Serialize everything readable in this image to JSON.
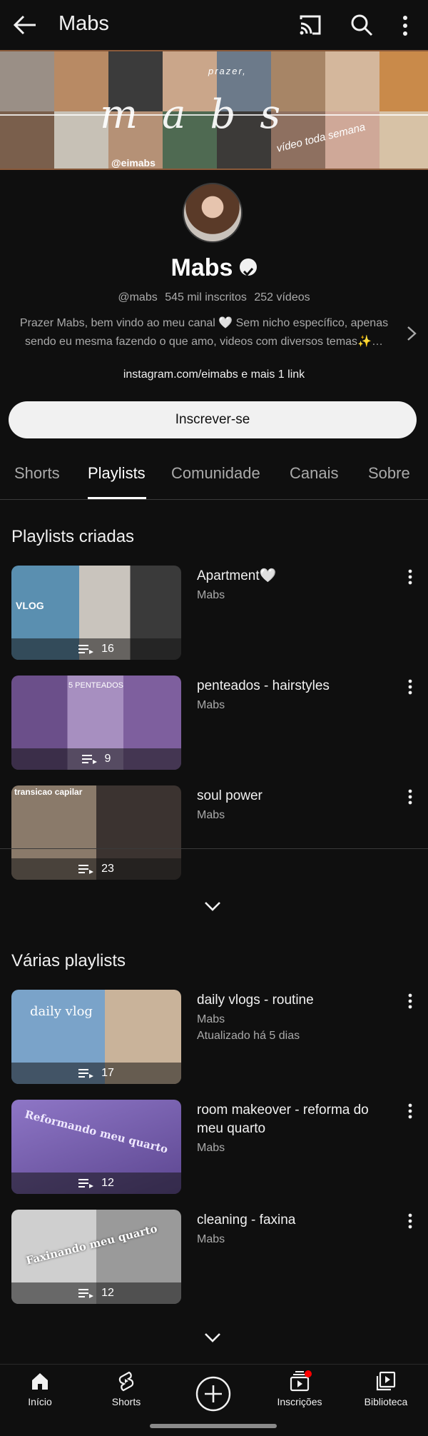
{
  "appbar": {
    "title": "Mabs"
  },
  "banner": {
    "cursive_text": "mabs",
    "handle": "@eimabs",
    "prazer": "prazer,",
    "tagline": "vídeo toda semana"
  },
  "channel": {
    "name": "Mabs",
    "handle": "@mabs",
    "subscribers": "545 mil inscritos",
    "videos": "252 vídeos",
    "description": "Prazer Mabs, bem vindo ao meu canal 🤍 Sem nicho específico, apenas sendo eu mesma fazendo o que amo, videos com diversos temas✨…",
    "links": "instagram.com/eimabs e mais 1 link",
    "subscribe_label": "Inscrever-se"
  },
  "tabs": [
    {
      "label": "Shorts"
    },
    {
      "label": "Playlists",
      "active": true
    },
    {
      "label": "Comunidade"
    },
    {
      "label": "Canais"
    },
    {
      "label": "Sobre"
    }
  ],
  "created": {
    "title": "Playlists criadas",
    "items": [
      {
        "title": "Apartment🤍",
        "channel": "Mabs",
        "count": "16",
        "thumb_text": "VLOG"
      },
      {
        "title": "penteados - hairstyles",
        "channel": "Mabs",
        "count": "9",
        "thumb_text": "5 PENTEADOS"
      },
      {
        "title": "soul power",
        "channel": "Mabs",
        "count": "23",
        "thumb_text": "transicao capilar"
      }
    ]
  },
  "various": {
    "title": "Várias playlists",
    "items": [
      {
        "title": "daily vlogs - routine",
        "channel": "Mabs",
        "updated": "Atualizado há 5 dias",
        "count": "17",
        "thumb_text": "daily vlog"
      },
      {
        "title": "room makeover - reforma do meu quarto",
        "channel": "Mabs",
        "count": "12",
        "thumb_text": "Reformando meu quarto"
      },
      {
        "title": "cleaning - faxina",
        "channel": "Mabs",
        "count": "12",
        "thumb_text": "Faxinando meu quarto"
      }
    ]
  },
  "bottomnav": [
    {
      "label": "Início"
    },
    {
      "label": "Shorts"
    },
    {
      "label": ""
    },
    {
      "label": "Inscrições"
    },
    {
      "label": "Biblioteca"
    }
  ],
  "colors": {
    "background": "#0f0f0f",
    "text": "#f1f1f1",
    "secondary": "#aaaaaa",
    "notification": "#ff0000"
  }
}
